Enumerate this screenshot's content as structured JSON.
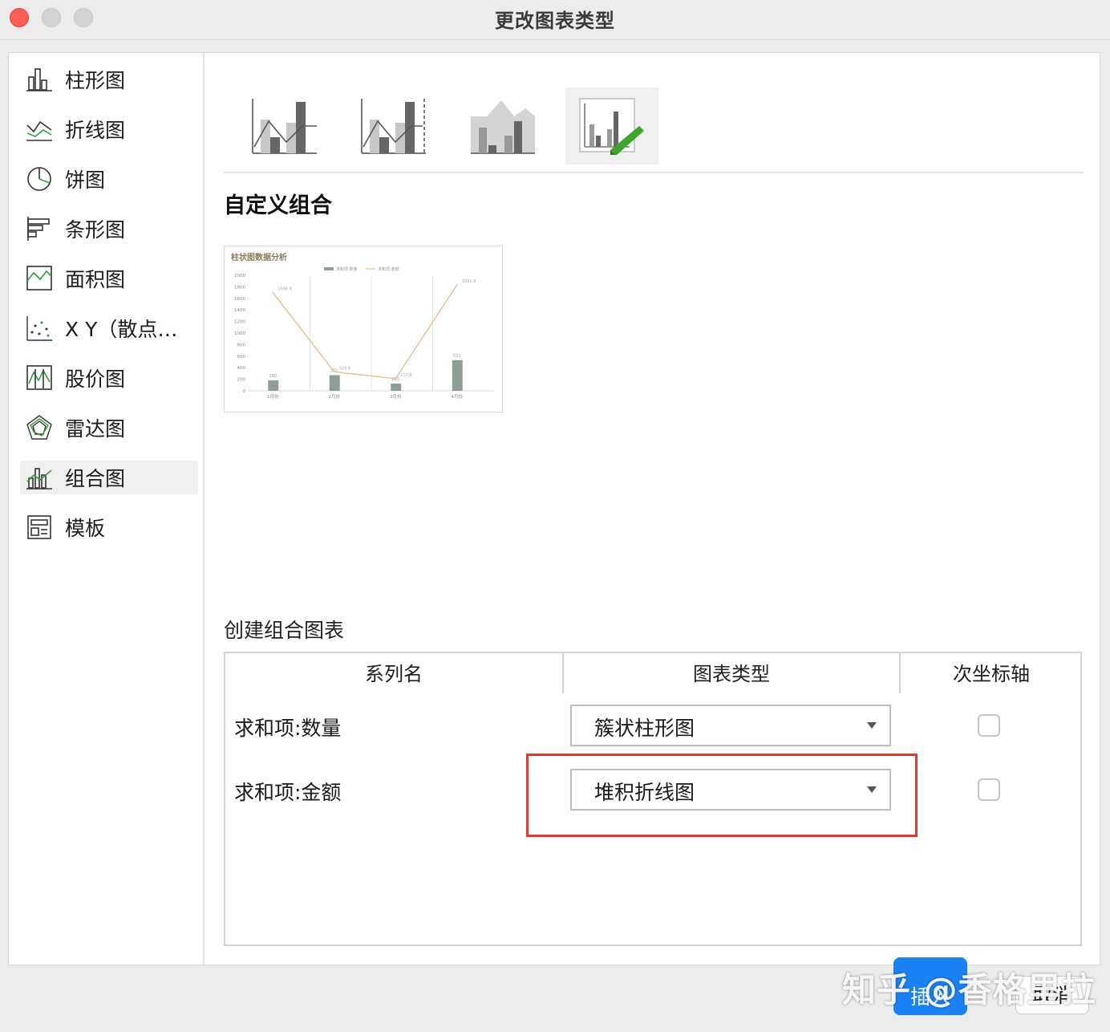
{
  "window": {
    "title": "更改图表类型"
  },
  "sidebar": {
    "items": [
      {
        "label": "柱形图",
        "icon": "column-chart-icon"
      },
      {
        "label": "折线图",
        "icon": "line-chart-icon"
      },
      {
        "label": "饼图",
        "icon": "pie-chart-icon"
      },
      {
        "label": "条形图",
        "icon": "bar-chart-icon"
      },
      {
        "label": "面积图",
        "icon": "area-chart-icon"
      },
      {
        "label": "X Y（散点…",
        "icon": "scatter-chart-icon"
      },
      {
        "label": "股价图",
        "icon": "stock-chart-icon"
      },
      {
        "label": "雷达图",
        "icon": "radar-chart-icon"
      },
      {
        "label": "组合图",
        "icon": "combo-chart-icon",
        "active": true
      },
      {
        "label": "模板",
        "icon": "template-icon"
      }
    ]
  },
  "main": {
    "subtypes": [
      "column-line-icon",
      "column-line-secondary-axis-icon",
      "stacked-area-column-icon",
      "custom-combo-icon"
    ],
    "section_title": "自定义组合",
    "create_label": "创建组合图表"
  },
  "preview_chart": {
    "chart_data": {
      "type": "bar",
      "title": "柱状图数据分析",
      "legend": [
        "求和项:数量",
        "求和项:金额"
      ],
      "categories": [
        "1月份",
        "2月份",
        "3月份",
        "4月份"
      ],
      "series": [
        {
          "name": "求和项:数量",
          "type": "bar",
          "values": [
            180,
            271,
            125,
            531
          ]
        },
        {
          "name": "求和项:金额",
          "type": "line",
          "values": [
            1698.9,
            329.8,
            210.6,
            1831.9
          ]
        }
      ],
      "ylim": [
        0,
        2000
      ],
      "yticks": [
        "0",
        "200",
        "400",
        "600",
        "800",
        "1000",
        "1200",
        "1400",
        "1600",
        "1800",
        "2000"
      ],
      "data_labels": [
        "180",
        "271",
        "125",
        "531",
        "1698.9",
        "329.8",
        "210.6",
        "1831.9"
      ],
      "colors": {
        "bar": "#8f9e93",
        "line": "#e3b98a"
      }
    }
  },
  "table": {
    "headers": {
      "series": "系列名",
      "type": "图表类型",
      "secondary": "次坐标轴"
    },
    "rows": [
      {
        "name": "求和项:数量",
        "chart_type": "簇状柱形图",
        "secondary": false
      },
      {
        "name": "求和项:金额",
        "chart_type": "堆积折线图",
        "secondary": false
      }
    ]
  },
  "footer": {
    "insert_label": "插入",
    "cancel_label": "取消"
  },
  "watermark": "知乎 @香格里拉",
  "colors": {
    "accent": "#1a82f5",
    "highlight": "#e03a2b",
    "close": "#fe5f57"
  }
}
